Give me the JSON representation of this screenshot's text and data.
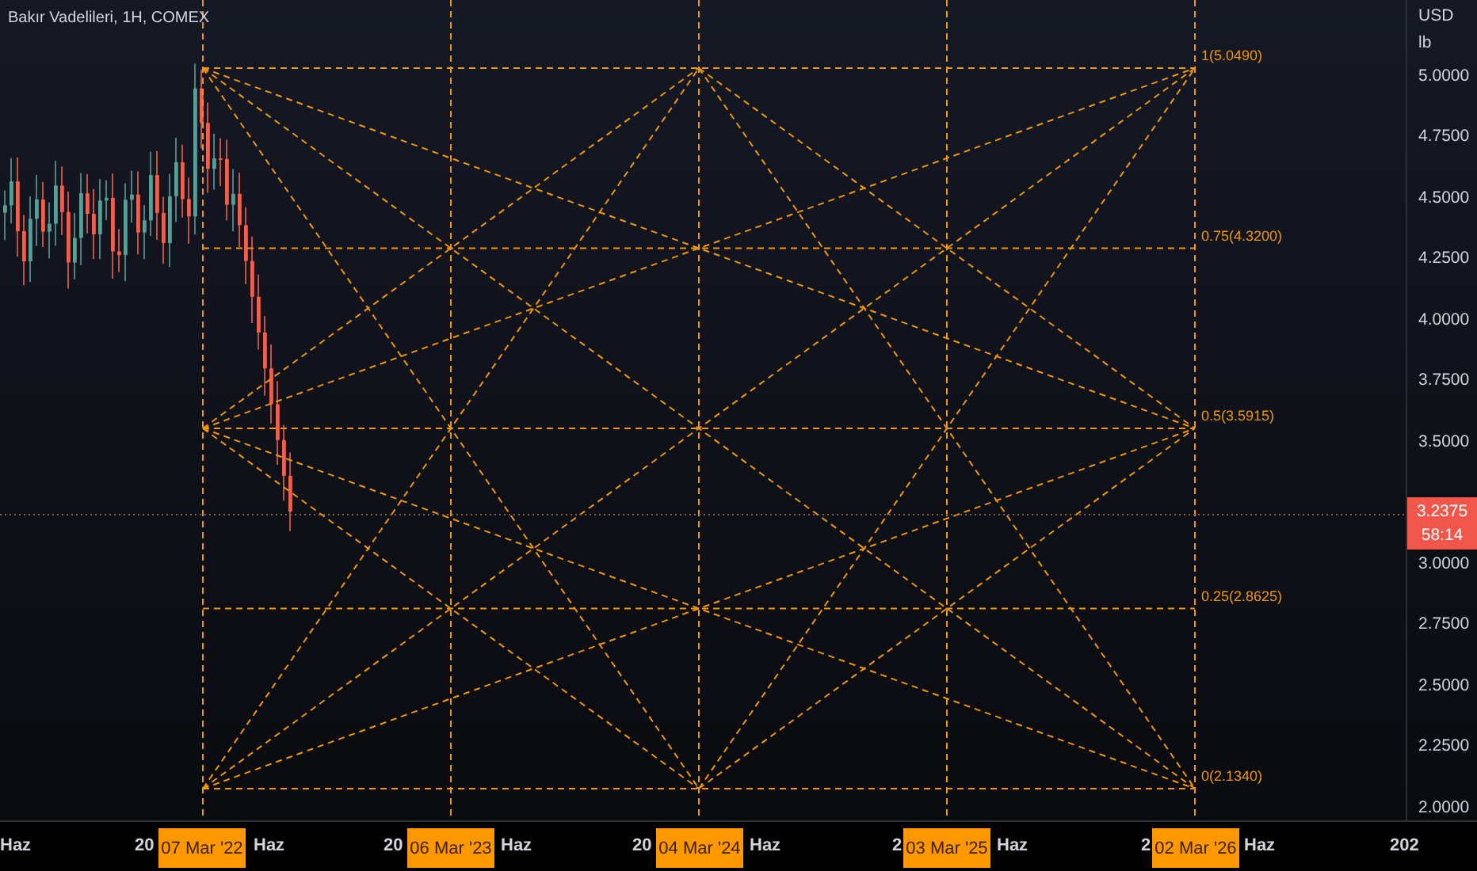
{
  "title": "Bakır Vadelileri, 1H, COMEX",
  "price_axis": {
    "currency": "USD",
    "unit": "lb",
    "ticks": [
      "5.0000",
      "4.7500",
      "4.5000",
      "4.2500",
      "4.0000",
      "3.7500",
      "3.5000",
      "3.0000",
      "2.7500",
      "2.5000",
      "2.2500",
      "2.0000"
    ]
  },
  "last_price": {
    "value": "3.2375",
    "countdown": "58:14"
  },
  "gann_box": {
    "levels": [
      {
        "label": "1(5.0490)"
      },
      {
        "label": "0.75(4.3200)"
      },
      {
        "label": "0.5(3.5915)"
      },
      {
        "label": "0.25(2.8625)"
      },
      {
        "label": "0(2.1340)"
      }
    ]
  },
  "time_axis": {
    "labels": [
      {
        "text": "Haz",
        "kind": "tick"
      },
      {
        "text": "20",
        "kind": "tick"
      },
      {
        "text": "07 Mar '22",
        "kind": "marker"
      },
      {
        "text": "Haz",
        "kind": "tick"
      },
      {
        "text": "20",
        "kind": "tick"
      },
      {
        "text": "06 Mar '23",
        "kind": "marker"
      },
      {
        "text": "Haz",
        "kind": "tick"
      },
      {
        "text": "20",
        "kind": "tick"
      },
      {
        "text": "04 Mar '24",
        "kind": "marker"
      },
      {
        "text": "Haz",
        "kind": "tick"
      },
      {
        "text": "2",
        "kind": "tick"
      },
      {
        "text": "03 Mar '25",
        "kind": "marker"
      },
      {
        "text": "Haz",
        "kind": "tick"
      },
      {
        "text": "2",
        "kind": "tick"
      },
      {
        "text": "02 Mar '26",
        "kind": "marker"
      },
      {
        "text": "Haz",
        "kind": "tick"
      },
      {
        "text": "202",
        "kind": "tick"
      }
    ]
  }
}
